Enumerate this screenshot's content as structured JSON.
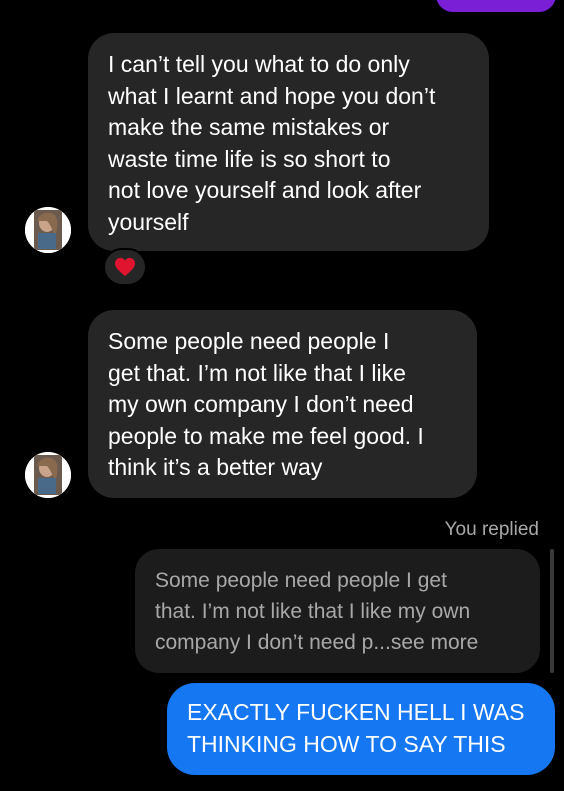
{
  "messages": {
    "incoming_1": "I can’t tell you what to do only\nwhat I learnt and hope you don’t\nmake the same mistakes or\nwaste time life is so short to\nnot love yourself and look after\nyourself",
    "incoming_1_reaction": "heart-icon",
    "incoming_2": "Some people need people I\nget that. I’m not like that I like\nmy own company I don’t need\npeople to make me feel good. I\nthink it’s a better way",
    "reply_label": "You replied",
    "quoted_text": "Some people need people I get\nthat. I’m not like that I like my own\ncompany I don’t need p...see more",
    "outgoing": "EXACTLY FUCKEN HELL I WAS\nTHINKING HOW TO SAY THIS"
  },
  "colors": {
    "incoming_bubble": "#262626",
    "outgoing_bubble": "#1677f2",
    "top_bubble": "#7a1fd6",
    "reaction_heart": "#e0142e",
    "muted_text": "#a8a8a8"
  }
}
